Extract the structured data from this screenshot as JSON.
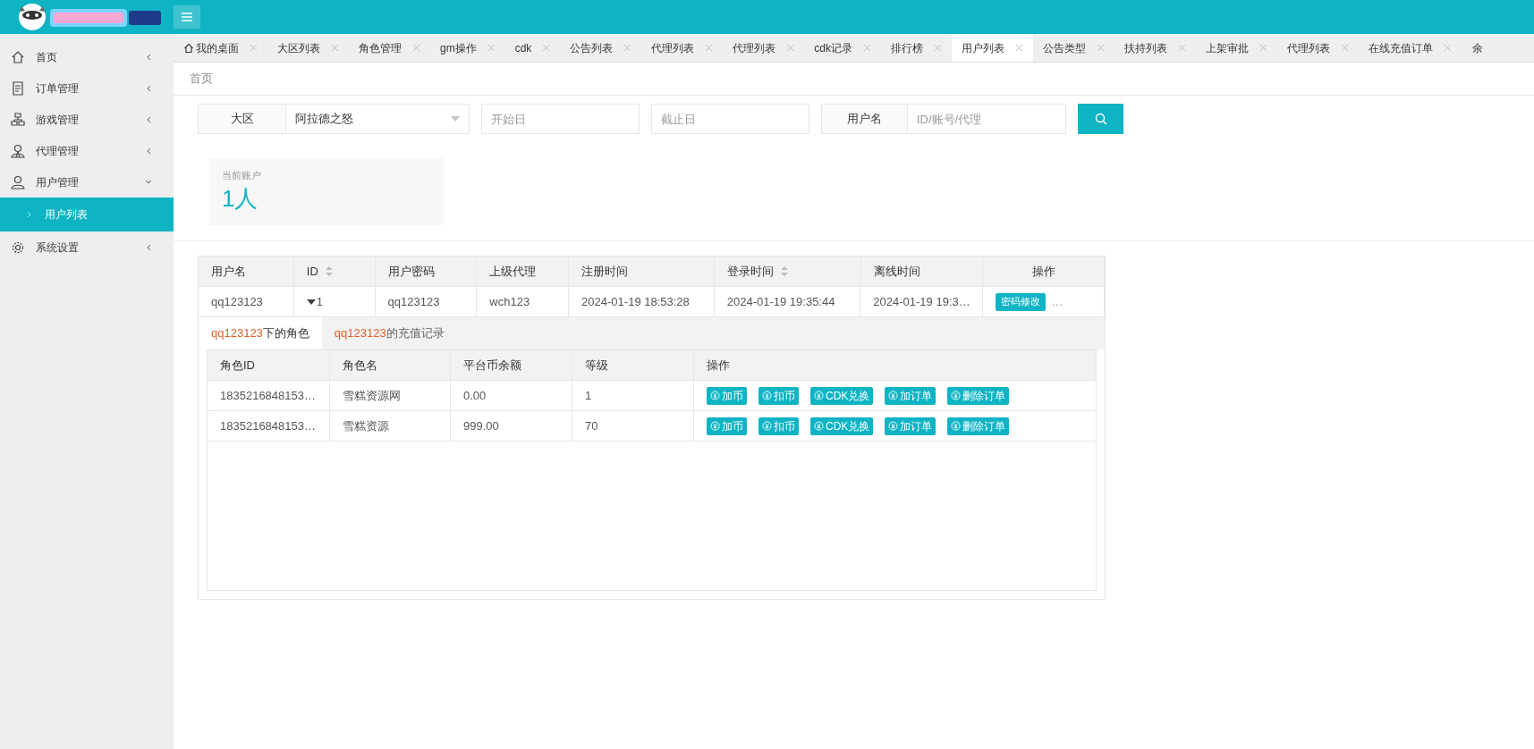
{
  "sidebar": {
    "items": [
      {
        "label": "首页",
        "expanded": false
      },
      {
        "label": "订单管理",
        "expanded": false
      },
      {
        "label": "游戏管理",
        "expanded": false
      },
      {
        "label": "代理管理",
        "expanded": false
      },
      {
        "label": "用户管理",
        "expanded": true,
        "children": [
          {
            "label": "用户列表",
            "selected": true
          }
        ]
      },
      {
        "label": "系统设置",
        "expanded": false
      }
    ]
  },
  "tabs": [
    {
      "label": "我的桌面",
      "selected": false,
      "kind": "home"
    },
    {
      "label": "大区列表",
      "selected": false
    },
    {
      "label": "角色管理",
      "selected": false
    },
    {
      "label": "gm操作",
      "selected": false
    },
    {
      "label": "cdk",
      "selected": false
    },
    {
      "label": "公告列表",
      "selected": false
    },
    {
      "label": "代理列表",
      "selected": false
    },
    {
      "label": "代理列表",
      "selected": false
    },
    {
      "label": "cdk记录",
      "selected": false
    },
    {
      "label": "排行榜",
      "selected": false
    },
    {
      "label": "用户列表",
      "selected": true
    },
    {
      "label": "公告类型",
      "selected": false
    },
    {
      "label": "扶持列表",
      "selected": false
    },
    {
      "label": "上架审批",
      "selected": false
    },
    {
      "label": "代理列表",
      "selected": false
    },
    {
      "label": "在线充值订单",
      "selected": false
    },
    {
      "label": "余",
      "selected": false
    }
  ],
  "breadcrumb": "首页",
  "filters": {
    "region_label": "大区",
    "region_value": "阿拉德之怒",
    "start_placeholder": "开始日",
    "end_placeholder": "截止日",
    "user_label": "用户名",
    "user_placeholder": "ID/账号/代理"
  },
  "stat": {
    "label": "当前账户",
    "value": "1人"
  },
  "table": {
    "columns": [
      {
        "label": "用户名"
      },
      {
        "label": "ID",
        "sortable": true
      },
      {
        "label": "用户密码"
      },
      {
        "label": "上级代理"
      },
      {
        "label": "注册时间"
      },
      {
        "label": "登录时间",
        "sortable": true
      },
      {
        "label": "离线时间"
      },
      {
        "label": "操作"
      }
    ],
    "rows": [
      {
        "cells": [
          "qq123123",
          "1",
          "qq123123",
          "wch123",
          "2024-01-19 18:53:28",
          "2024-01-19 19:35:44",
          "2024-01-19 19:3…"
        ],
        "expanded": true,
        "action": "密码修改",
        "more": "…",
        "subtabs": [
          {
            "name": "qq123123",
            "label": "下的角色",
            "selected": true
          },
          {
            "name": "qq123123",
            "label": "的充值记录",
            "selected": false
          }
        ],
        "subtable": {
          "columns": [
            "角色ID",
            "角色名",
            "平台币余额",
            "等级",
            "操作"
          ],
          "rows": [
            {
              "cells": [
                "1835216848153…",
                "雪糕资源网",
                "0.00",
                "1"
              ],
              "actions": [
                "加币",
                "扣币",
                "CDK兑换",
                "加订单",
                "删除订单"
              ]
            },
            {
              "cells": [
                "1835216848153…",
                "雪糕资源",
                "999.00",
                "70"
              ],
              "actions": [
                "加币",
                "扣币",
                "CDK兑换",
                "加订单",
                "删除订单"
              ]
            }
          ]
        }
      }
    ]
  }
}
